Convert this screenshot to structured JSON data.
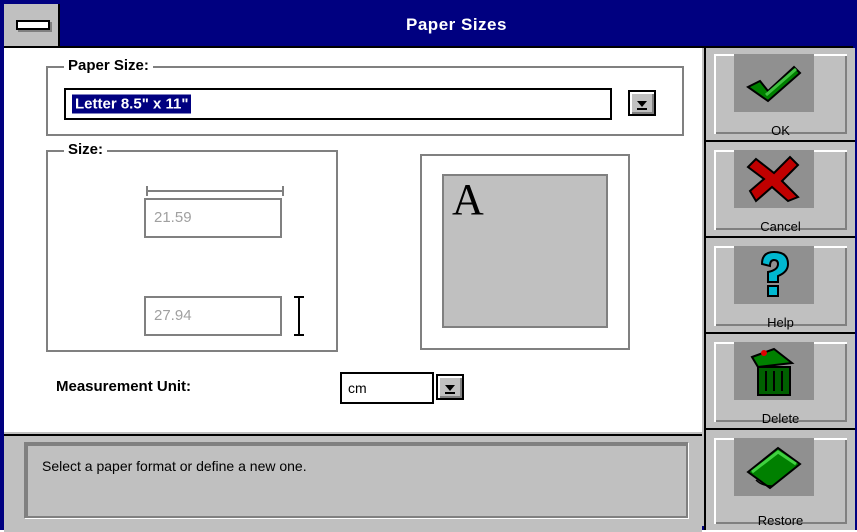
{
  "window": {
    "title": "Paper Sizes"
  },
  "paper_size": {
    "group_label": "Paper Size:",
    "value": "Letter 8.5\" x 11\""
  },
  "size": {
    "group_label": "Size:",
    "width": "21.59",
    "height": "27.94"
  },
  "preview": {
    "letter": "A"
  },
  "measurement": {
    "label": "Measurement Unit:",
    "value": "cm"
  },
  "status": {
    "text": "Select a paper format or define a new one."
  },
  "toolbar": {
    "buttons": [
      {
        "label": "OK",
        "icon": "checkmark-icon",
        "color": "#008000"
      },
      {
        "label": "Cancel",
        "icon": "x-mark-icon",
        "color": "#c00000"
      },
      {
        "label": "Help",
        "icon": "question-mark-icon",
        "color": "#00b0c0"
      },
      {
        "label": "Delete",
        "icon": "trash-can-icon",
        "color": "#006000"
      },
      {
        "label": "Restore",
        "icon": "eraser-icon",
        "color": "#008000"
      }
    ]
  },
  "colors": {
    "title_bar": "#000080",
    "face": "#c0c0c0",
    "selection": "#000080"
  }
}
